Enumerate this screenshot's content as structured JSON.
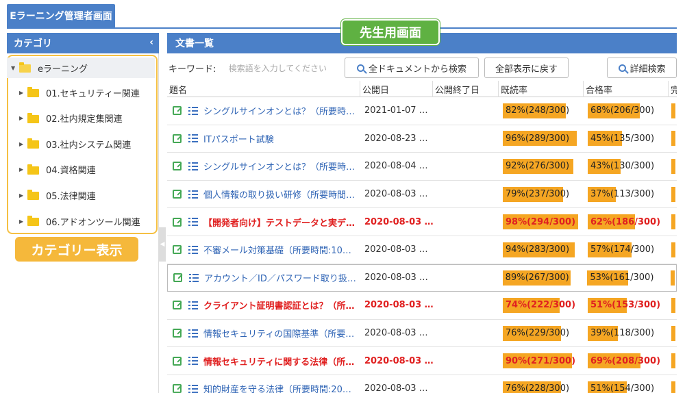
{
  "app": {
    "tab_title": "Eラーニング管理者画面"
  },
  "sidebar": {
    "header": "カテゴリ",
    "collapse_glyph": "‹",
    "root": "eラーニング",
    "items": [
      {
        "label": "01.セキュリティー関連"
      },
      {
        "label": "02.社内規定集関連"
      },
      {
        "label": "03.社内システム関連"
      },
      {
        "label": "04.資格関連"
      },
      {
        "label": "05.法律関連"
      },
      {
        "label": "06.アドオンツール関連"
      }
    ]
  },
  "annotations": {
    "category": "カテゴリー表示",
    "teacher": "先生用画面"
  },
  "documents": {
    "header": "文書一覧",
    "keyword_label": "キーワード:",
    "keyword_placeholder": "検索語を入力してください",
    "btn_search_all": "全ドキュメントから検索",
    "btn_show_all": "全部表示に戻す",
    "btn_detail": "詳細検索",
    "columns": {
      "title": "題名",
      "pub": "公開日",
      "end": "公開終了日",
      "rate": "既読率",
      "pass": "合格率",
      "more": "完"
    },
    "rows": [
      {
        "title": "シングルサインオンとは？（所要時間…",
        "pub": "2021-01-07 …",
        "rate": "82%(248/300)",
        "rate_pct": 82,
        "pass": "68%(206/300)",
        "pass_pct": 68,
        "red": false
      },
      {
        "title": "ITパスポート試験",
        "pub": "2020-08-23 …",
        "rate": "96%(289/300)",
        "rate_pct": 96,
        "pass": "45%(135/300)",
        "pass_pct": 45,
        "red": false
      },
      {
        "title": "シングルサインオンとは？（所要時間…",
        "pub": "2020-08-04 …",
        "rate": "92%(276/300)",
        "rate_pct": 92,
        "pass": "43%(130/300)",
        "pass_pct": 43,
        "red": false
      },
      {
        "title": "個人情報の取り扱い研修（所要時間…",
        "pub": "2020-08-03 …",
        "rate": "79%(237/300)",
        "rate_pct": 79,
        "pass": "37%(113/300)",
        "pass_pct": 37,
        "red": false
      },
      {
        "title": "【開発者向け】テストデータと実デ…",
        "pub": "2020-08-03 …",
        "rate": "98%(294/300)",
        "rate_pct": 98,
        "pass": "62%(186/300)",
        "pass_pct": 62,
        "red": true
      },
      {
        "title": "不審メール対策基礎（所要時間:10…",
        "pub": "2020-08-03 …",
        "rate": "94%(283/300)",
        "rate_pct": 94,
        "pass": "57%(174/300)",
        "pass_pct": 57,
        "red": false
      },
      {
        "title": "アカウント／ID／パスワード取り扱…",
        "pub": "2020-08-03 …",
        "rate": "89%(267/300)",
        "rate_pct": 89,
        "pass": "53%(161/300)",
        "pass_pct": 53,
        "red": false,
        "hl": true
      },
      {
        "title": "クライアント証明書認証とは？（所…",
        "pub": "2020-08-03 …",
        "rate": "74%(222/300)",
        "rate_pct": 74,
        "pass": "51%(153/300)",
        "pass_pct": 51,
        "red": true
      },
      {
        "title": "情報セキュリティの国際基準（所要…",
        "pub": "2020-08-03 …",
        "rate": "76%(229/300)",
        "rate_pct": 76,
        "pass": "39%(118/300)",
        "pass_pct": 39,
        "red": false
      },
      {
        "title": "情報セキュリティに関する法律（所…",
        "pub": "2020-08-03 …",
        "rate": "90%(271/300)",
        "rate_pct": 90,
        "pass": "69%(208/300)",
        "pass_pct": 69,
        "red": true
      },
      {
        "title": "知的財産を守る法律（所要時間:20…",
        "pub": "2020-08-03 …",
        "rate": "76%(228/300)",
        "rate_pct": 76,
        "pass": "51%(154/300)",
        "pass_pct": 51,
        "red": false
      }
    ]
  },
  "colors": {
    "primary": "#4b80c8",
    "bar": "#f5a623",
    "accent_red": "#e02020",
    "badge_yellow": "#f5b83b",
    "badge_green": "#5fb142"
  }
}
